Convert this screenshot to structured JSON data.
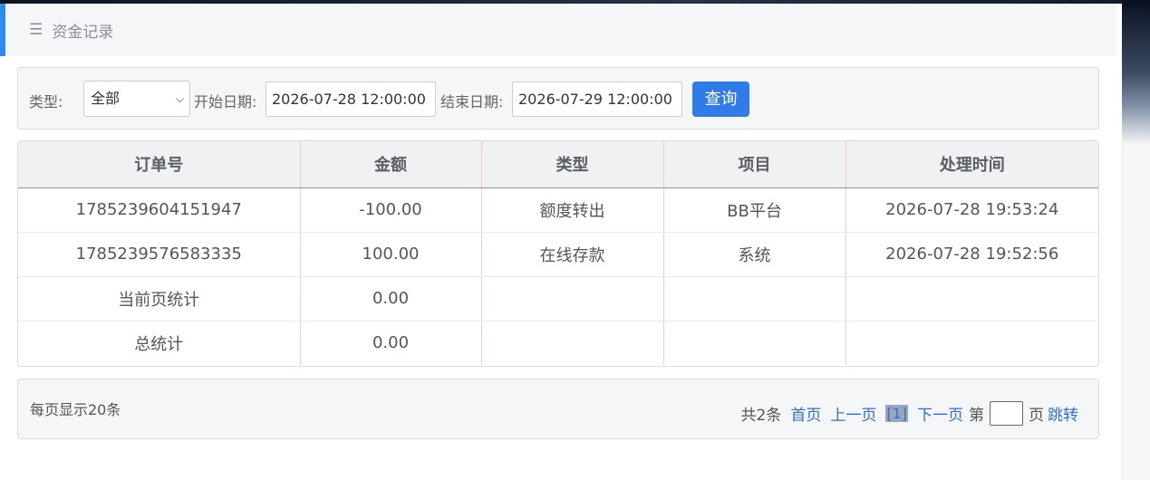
{
  "header": {
    "title": "资金记录",
    "menu_icon": "menu-icon"
  },
  "filter": {
    "type_label": "类型:",
    "type_value": "全部",
    "start_label": "开始日期:",
    "start_value": "2026-07-28 12:00:00",
    "end_label": "结束日期:",
    "end_value": "2026-07-29 12:00:00",
    "query_button": "查询"
  },
  "table": {
    "headers": [
      "订单号",
      "金额",
      "类型",
      "项目",
      "处理时间"
    ],
    "rows": [
      [
        "1785239604151947",
        "-100.00",
        "额度转出",
        "BB平台",
        "2026-07-28 19:53:24"
      ],
      [
        "1785239576583335",
        "100.00",
        "在线存款",
        "系统",
        "2026-07-28 19:52:56"
      ],
      [
        "当前页统计",
        "0.00",
        "",
        "",
        ""
      ],
      [
        "总统计",
        "0.00",
        "",
        "",
        ""
      ]
    ]
  },
  "pager": {
    "per_page": "每页显示20条",
    "total": "共2条",
    "first": "首页",
    "prev": "上一页",
    "current": "[1]",
    "next": "下一页",
    "page_prefix": "第",
    "page_input": "",
    "page_suffix": "页",
    "jump": "跳转"
  },
  "colors": {
    "accent": "#2f7be8",
    "link": "#2f6fd6"
  }
}
